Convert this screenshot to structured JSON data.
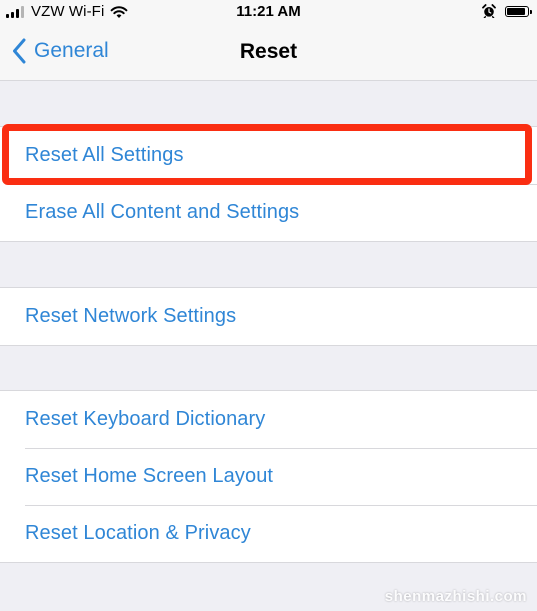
{
  "status_bar": {
    "carrier": "VZW Wi-Fi",
    "time": "11:21 AM",
    "signal_bars_filled": 3,
    "signal_bars_total": 4,
    "icons": [
      "signal-icon",
      "wifi-icon",
      "alarm-icon",
      "battery-icon"
    ]
  },
  "nav": {
    "back_label": "General",
    "title": "Reset"
  },
  "groups": [
    {
      "items": [
        {
          "label": "Reset All Settings",
          "highlighted": true
        },
        {
          "label": "Erase All Content and Settings"
        }
      ]
    },
    {
      "items": [
        {
          "label": "Reset Network Settings"
        }
      ]
    },
    {
      "items": [
        {
          "label": "Reset Keyboard Dictionary"
        },
        {
          "label": "Reset Home Screen Layout"
        },
        {
          "label": "Reset Location & Privacy"
        }
      ]
    }
  ],
  "watermark": "shenmazhishi.com",
  "colors": {
    "link": "#2f86d6",
    "highlight_border": "#fa2e12",
    "background": "#efeff4"
  }
}
